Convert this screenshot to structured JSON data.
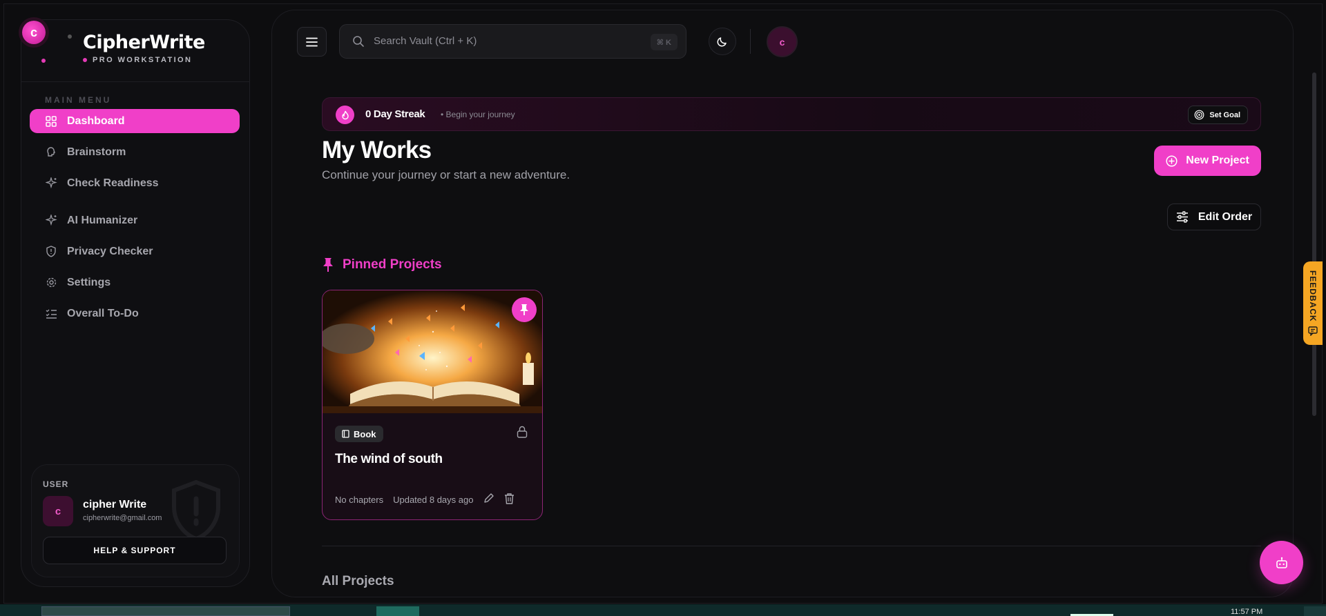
{
  "brand": {
    "logo_letter": "c",
    "name": "CipherWrite",
    "subtitle": "PRO WORKSTATION"
  },
  "sidebar": {
    "menu_title": "MAIN MENU",
    "items": [
      {
        "label": "Dashboard",
        "icon": "grid-icon",
        "active": true
      },
      {
        "label": "Brainstorm",
        "icon": "brain-icon",
        "active": false
      },
      {
        "label": "Check Readiness",
        "icon": "sparkle-icon",
        "active": false
      },
      {
        "label": "AI Humanizer",
        "icon": "sparkle-icon",
        "active": false
      },
      {
        "label": "Privacy Checker",
        "icon": "shield-icon",
        "active": false
      },
      {
        "label": "Settings",
        "icon": "gear-icon",
        "active": false
      },
      {
        "label": "Overall To-Do",
        "icon": "checklist-icon",
        "active": false
      }
    ],
    "user": {
      "label": "USER",
      "avatar_letter": "c",
      "name": "cipher Write",
      "email": "cipherwrite@gmail.com",
      "help_label": "HELP & SUPPORT"
    }
  },
  "topbar": {
    "search_placeholder": "Search Vault (Ctrl + K)",
    "shortcut": "⌘ K",
    "avatar_letter": "c"
  },
  "streak": {
    "title": "0 Day Streak",
    "subtitle": "• Begin your journey",
    "goal_label": "Set Goal"
  },
  "header": {
    "title": "My Works",
    "subtitle": "Continue your journey or start a new adventure.",
    "new_project_label": "New Project",
    "edit_order_label": "Edit Order"
  },
  "pinned": {
    "heading": "Pinned Projects",
    "projects": [
      {
        "type": "Book",
        "title": "The wind of south",
        "chapters": "No chapters",
        "updated": "Updated 8 days ago"
      }
    ]
  },
  "all_projects": {
    "heading": "All Projects"
  },
  "feedback": {
    "label": "FEEDBACK"
  },
  "taskbar": {
    "time": "11:57 PM"
  },
  "colors": {
    "accent": "#f03fc8",
    "background": "#0e0e10",
    "feedback": "#f5a623"
  }
}
